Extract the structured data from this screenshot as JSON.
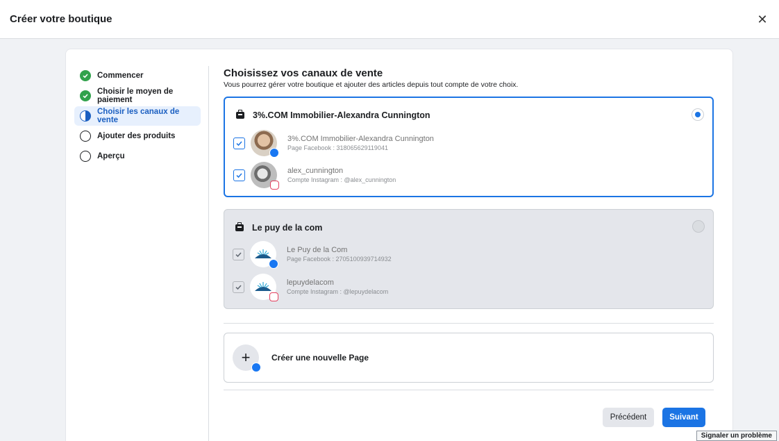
{
  "modal": {
    "title": "Créer votre boutique"
  },
  "steps": [
    {
      "label": "Commencer",
      "state": "done"
    },
    {
      "label": "Choisir le moyen de paiement",
      "state": "done"
    },
    {
      "label": "Choisir les canaux de vente",
      "state": "active"
    },
    {
      "label": "Ajouter des produits",
      "state": "todo"
    },
    {
      "label": "Aperçu",
      "state": "todo"
    }
  ],
  "main": {
    "title": "Choisissez vos canaux de vente",
    "subtitle": "Vous pourrez gérer votre boutique et ajouter des articles depuis tout compte de votre choix."
  },
  "channels": [
    {
      "name": "3%.COM Immobilier-Alexandra Cunnington",
      "selected": true,
      "accounts": [
        {
          "name": "3%.COM Immobilier-Alexandra Cunnington",
          "detail": "Page Facebook : 318065629119041",
          "platform": "facebook-icon"
        },
        {
          "name": "alex_cunnington",
          "detail": "Compte Instagram : @alex_cunnington",
          "platform": "instagram-icon"
        }
      ]
    },
    {
      "name": "Le puy de la com",
      "selected": false,
      "accounts": [
        {
          "name": "Le Puy de la Com",
          "detail": "Page Facebook : 2705100939714932",
          "platform": "facebook-icon"
        },
        {
          "name": "lepuydelacom",
          "detail": "Compte Instagram : @lepuydelacom",
          "platform": "instagram-icon"
        }
      ]
    }
  ],
  "create_page": {
    "label": "Créer une nouvelle Page"
  },
  "buttons": {
    "previous": "Précédent",
    "next": "Suivant"
  },
  "report": {
    "label": "Signaler un problème"
  },
  "colors": {
    "accent": "#1b74e4",
    "success": "#31a24c",
    "active_bg": "#e7f0fd"
  }
}
